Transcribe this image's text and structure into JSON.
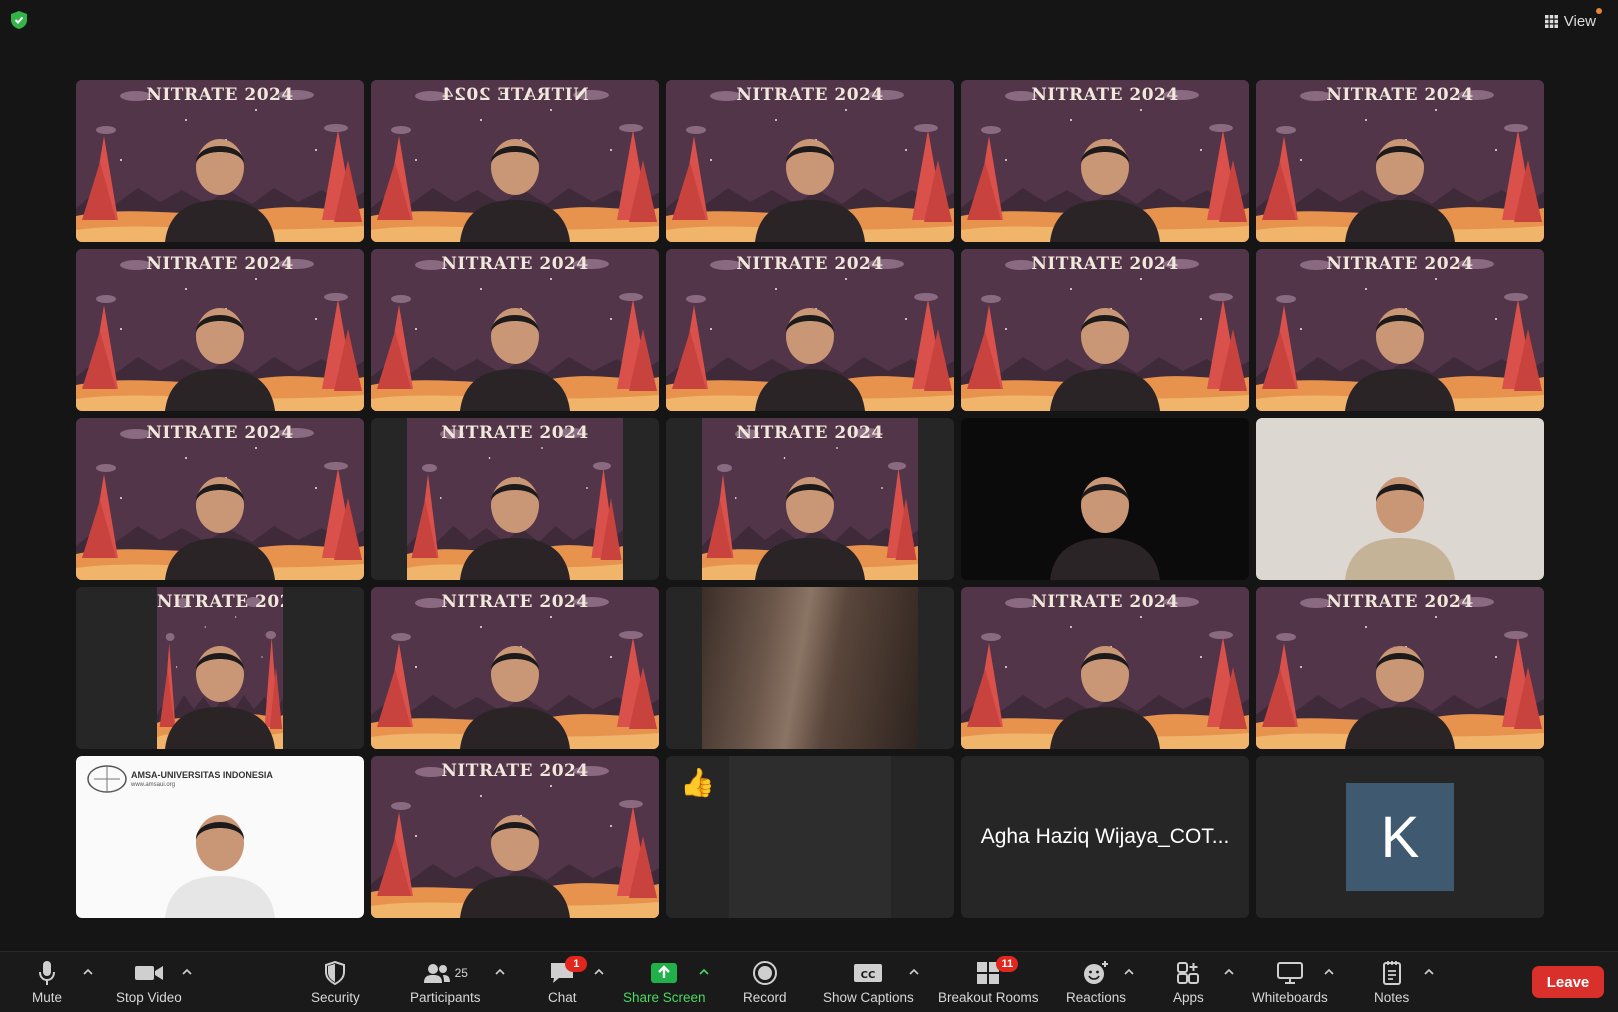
{
  "window": {
    "view_label": "View"
  },
  "background_banner": "NITRATE 2024",
  "tiles": [
    {
      "kind": "vbg"
    },
    {
      "kind": "vbg",
      "active": true,
      "mirror": true
    },
    {
      "kind": "vbg"
    },
    {
      "kind": "vbg"
    },
    {
      "kind": "vbg"
    },
    {
      "kind": "vbg"
    },
    {
      "kind": "vbg"
    },
    {
      "kind": "vbg"
    },
    {
      "kind": "vbg"
    },
    {
      "kind": "vbg"
    },
    {
      "kind": "vbg"
    },
    {
      "kind": "vbg-narrow"
    },
    {
      "kind": "vbg-narrow"
    },
    {
      "kind": "camera-dark"
    },
    {
      "kind": "camera-room"
    },
    {
      "kind": "vbg-narrower"
    },
    {
      "kind": "vbg"
    },
    {
      "kind": "camera-hair"
    },
    {
      "kind": "vbg"
    },
    {
      "kind": "vbg"
    },
    {
      "kind": "logo"
    },
    {
      "kind": "vbg"
    },
    {
      "kind": "reaction"
    },
    {
      "kind": "name"
    },
    {
      "kind": "avatar"
    }
  ],
  "logo_tile": {
    "org_name": "AMSA-UNIVERSITAS INDONESIA",
    "org_url": "www.amsaui.org"
  },
  "reaction_tile": {
    "emoji": "👍"
  },
  "name_tile": {
    "display_name": "Agha Haziq Wijaya_COT..."
  },
  "avatar_tile": {
    "initial": "K"
  },
  "toolbar": {
    "mute": "Mute",
    "stop_video": "Stop Video",
    "security": "Security",
    "participants": "Participants",
    "participants_count": "25",
    "chat": "Chat",
    "chat_badge": "1",
    "share_screen": "Share Screen",
    "record": "Record",
    "show_captions": "Show Captions",
    "breakout_rooms": "Breakout Rooms",
    "breakout_badge": "11",
    "reactions": "Reactions",
    "apps": "Apps",
    "whiteboards": "Whiteboards",
    "notes": "Notes",
    "leave": "Leave"
  },
  "colors": {
    "background": "#151515",
    "active_speaker": "#4cd964",
    "leave": "#d9302c",
    "badge": "#e0261d",
    "virtual_bg": "#523549"
  }
}
